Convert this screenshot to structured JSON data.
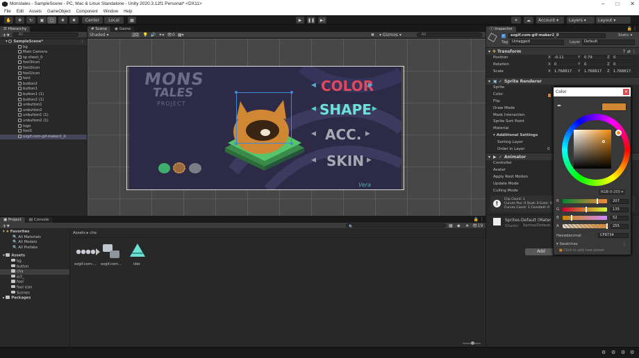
{
  "window": {
    "title": "Monstales - SampleScene - PC, Mac & Linux Standalone - Unity 2020.3.12f1 Personal* <DX11>"
  },
  "menu": [
    "File",
    "Edit",
    "Assets",
    "GameObject",
    "Component",
    "Window",
    "Help"
  ],
  "toolbar": {
    "pivot_label": "Center",
    "space_label": "Local",
    "account_label": "Account",
    "layers_label": "Layers",
    "layout_label": "Layout"
  },
  "hierarchy": {
    "tab_label": "Hierarchy",
    "search_placeholder": "All",
    "scene_name": "SampleScene*",
    "items": [
      "bg",
      "Main Camera",
      "sp sheet_0",
      "fool3icon",
      "fool2icon",
      "fool1icon",
      "font",
      "button2",
      "button1",
      "button1 (1)",
      "button2 (1)",
      "unbutton1",
      "unbutton2",
      "unbutton1 (1)",
      "unbutton2 (1)",
      "logo",
      "fool1",
      "ezgif.com-gif-maker2_0"
    ]
  },
  "scene": {
    "scene_tab": "Scene",
    "game_tab": "Game",
    "shading_mode": "Shaded",
    "mode_2d": "2D",
    "hidden_count": "0",
    "gizmos_label": "Gizmos",
    "search_placeholder": "All"
  },
  "game_art": {
    "logo_line1": "MONS",
    "logo_line2": "TALES",
    "logo_line3": "PROJECT",
    "menu_color": "COLOR",
    "menu_shape": "SHAPE",
    "menu_acc": "ACC.",
    "menu_skin": "SKIN",
    "signature": "Vera",
    "creature_color": "#CF8734"
  },
  "project": {
    "project_tab": "Project",
    "console_tab": "Console",
    "hidden_count": "19",
    "favorites_label": "Favorites",
    "favorites": [
      "All Materials",
      "All Models",
      "All Prefabs"
    ],
    "assets_label": "Assets",
    "asset_folders": [
      "bg",
      "button",
      "cha",
      "ect_",
      "fool",
      "fool icon",
      "Scenes"
    ],
    "packages_label": "Packages",
    "breadcrumb_root": "Assets",
    "breadcrumb_current": "cha",
    "files": [
      {
        "label": "ezgif.com-..."
      },
      {
        "label": "ezgif.com..."
      },
      {
        "label": "ider"
      }
    ]
  },
  "inspector": {
    "tab_label": "Inspector",
    "object_name": "ezgif.com-gif-maker2_0",
    "static_label": "Static",
    "tag_label": "Tag",
    "tag_value": "Untagged",
    "layer_label": "Layer",
    "layer_value": "Default",
    "transform_label": "Transform",
    "position_label": "Position",
    "rotation_label": "Rotation",
    "scale_label": "Scale",
    "position": {
      "x": "-0.11",
      "y": "0.79",
      "z": "0"
    },
    "rotation": {
      "x": "0",
      "y": "0",
      "z": "0"
    },
    "scale": {
      "x": "1.768817",
      "y": "1.768817",
      "z": "1.768817"
    },
    "sprite_renderer_label": "Sprite Renderer",
    "sprite_label": "Sprite",
    "color_label": "Color",
    "flip_label": "Flip",
    "draw_mode_label": "Draw Mode",
    "mask_label": "Mask Interaction",
    "sort_point_label": "Sprite Sort Point",
    "material_label": "Material",
    "additional_label": "Additional Settings",
    "sorting_layer_label": "Sorting Layer",
    "order_label": "Order in Layer",
    "order_value": "0",
    "animator_label": "Animator",
    "controller_label": "Controller",
    "avatar_label": "Avatar",
    "root_motion_label": "Apply Root Motion",
    "update_mode_label": "Update Mode",
    "culling_label": "Culling Mode",
    "clip_info_1": "Clip Count: 1",
    "clip_info_2": "Curves Pos: 0 Quat: 0 Euler: 0",
    "clip_info_3": "Curves Count: 1 Constant: 0",
    "material_name": "Sprites-Default (Mater",
    "shader_label": "Shader",
    "shader_value": "Sprites/Default",
    "add_component": "Add"
  },
  "color_picker": {
    "title": "Color",
    "mode_label": "RGB 0-255",
    "r": "207",
    "g": "135",
    "b": "52",
    "a": "255",
    "hex_label": "Hexadecimal",
    "hex_value": "CF8734",
    "swatches_label": "Swatches",
    "add_preset_hint": "Click to add new preset",
    "selected_color": "#CF8734"
  }
}
